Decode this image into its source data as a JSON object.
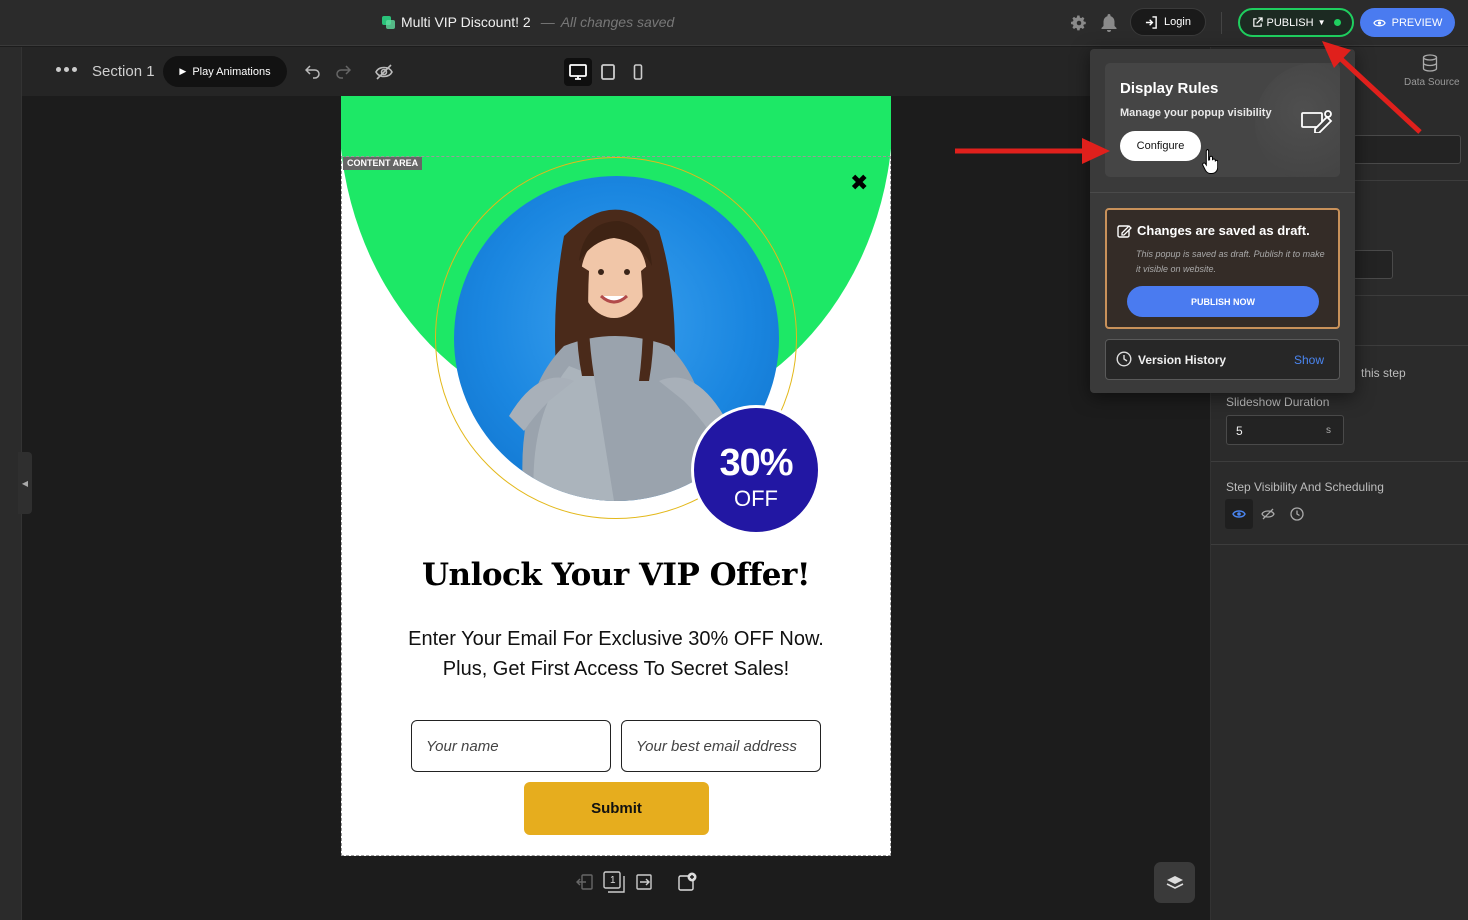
{
  "header": {
    "title": "Multi VIP Discount! 2",
    "separator": "—",
    "save_status": "All changes saved",
    "login_label": "Login",
    "publish_label": "PUBLISH",
    "preview_label": "PREVIEW"
  },
  "toolbar": {
    "section_label": "Section 1",
    "play_label": "Play Animations"
  },
  "popup": {
    "content_area_tag": "CONTENT AREA",
    "close_glyph": "✖",
    "badge_percent": "30%",
    "badge_off": "OFF",
    "headline": "Unlock Your VIP Offer!",
    "subtext_line1": "Enter Your Email For Exclusive 30% OFF Now.",
    "subtext_line2": "Plus, Get First Access To Secret Sales!",
    "name_placeholder": "Your name",
    "email_placeholder": "Your best email address",
    "submit_label": "Submit"
  },
  "steps": {
    "current": "1"
  },
  "right_panel": {
    "data_source_label": "Data Source",
    "step_text_fragment": "this step",
    "slideshow_label": "Slideshow Duration",
    "slideshow_value": "5",
    "slideshow_unit": "s",
    "visibility_label": "Step Visibility And Scheduling"
  },
  "dropdown": {
    "display_rules_title": "Display Rules",
    "display_rules_sub": "Manage your popup visibility",
    "configure_label": "Configure",
    "draft_title": "Changes are saved as draft.",
    "draft_desc": "This popup is saved as draft. Publish it to make it visible on website.",
    "publish_now_label": "PUBLISH NOW",
    "version_title": "Version History",
    "version_show": "Show"
  },
  "colors": {
    "accent_green": "#1fcf5f",
    "popup_green": "#1de866",
    "accent_blue": "#4a7bf0",
    "badge_blue": "#2217a3",
    "submit_yellow": "#e6ad1e",
    "draft_border": "#c8915a",
    "annotation_red": "#e0201c"
  }
}
